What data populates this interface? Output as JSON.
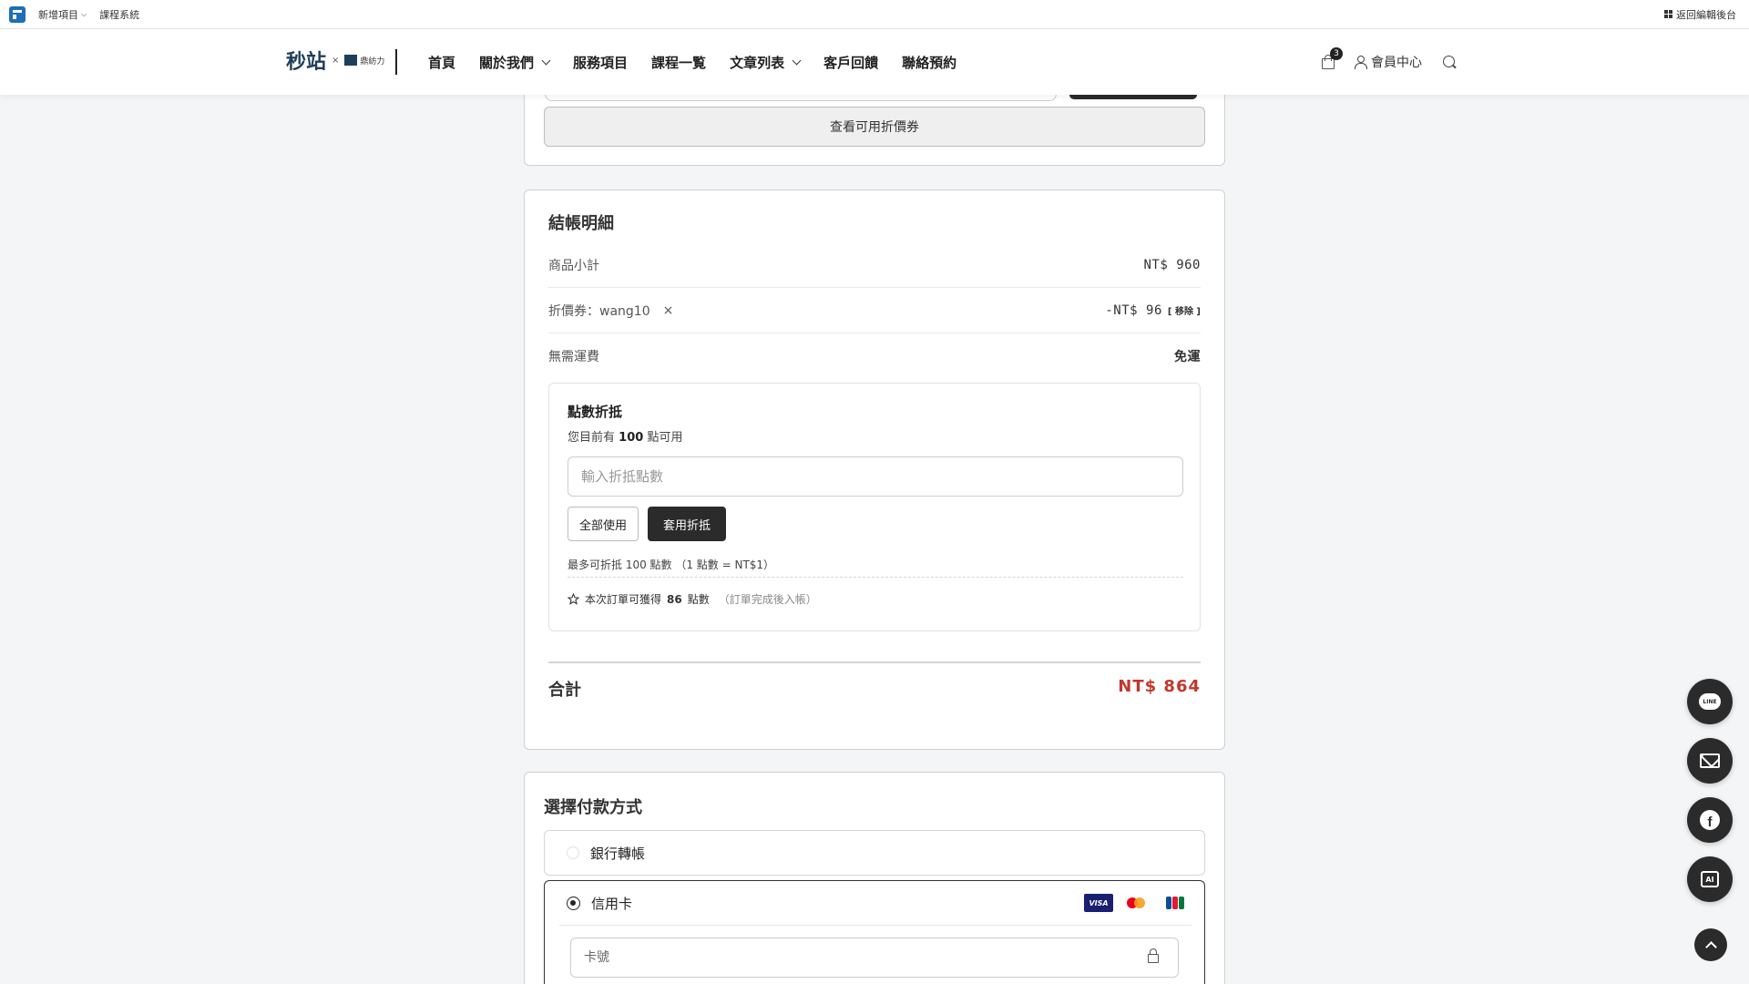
{
  "adminbar": {
    "new_item": "新增項目",
    "course_system": "課程系統",
    "back_to_admin": "返回編輯後台"
  },
  "header": {
    "brand_main": "秒站",
    "brand_x": "×",
    "brand_sub": "鼎紡力",
    "nav": [
      {
        "label": "首頁"
      },
      {
        "label": "關於我們"
      },
      {
        "label": "服務項目"
      },
      {
        "label": "課程一覧"
      },
      {
        "label": "文章列表"
      },
      {
        "label": "客戶回饋"
      },
      {
        "label": "聯絡預約"
      }
    ],
    "cart_count": "3",
    "member_label": "會員中心"
  },
  "coupon": {
    "view_coupons": "查看可用折價券"
  },
  "summary": {
    "title": "結帳明細",
    "subtotal_label": "商品小計",
    "subtotal_value": "NT$ 960",
    "coupon_label": "折價券：wang10",
    "coupon_remove_x": "×",
    "coupon_value": "-NT$ 96",
    "coupon_remove_link": "[ 移除 ]",
    "shipping_label": "無需運費",
    "shipping_value": "免運",
    "points": {
      "title": "點數折抵",
      "avail_prefix": "您目前有",
      "avail_amount": "100",
      "avail_suffix": "點可用",
      "input_placeholder": "輸入折抵點數",
      "use_all": "全部使用",
      "apply": "套用折抵",
      "max_text": "最多可折抵 100 點數 （1 點數 = NT$1）",
      "earn_prefix": "本次訂單可獲得",
      "earn_amount": "86",
      "earn_suffix": "點數",
      "earn_note": "（訂單完成後入帳）"
    },
    "total_label": "合計",
    "total_value": "NT$ 864"
  },
  "payment": {
    "title": "選擇付款方式",
    "bank_transfer": "銀行轉帳",
    "credit_card": "信用卡",
    "card_brands": [
      "VISA",
      "Mastercard",
      "JCB"
    ],
    "card_number_placeholder": "卡號"
  },
  "floating": {
    "line_label": "LINE",
    "facebook_glyph": "f",
    "ai_label": "AI"
  }
}
